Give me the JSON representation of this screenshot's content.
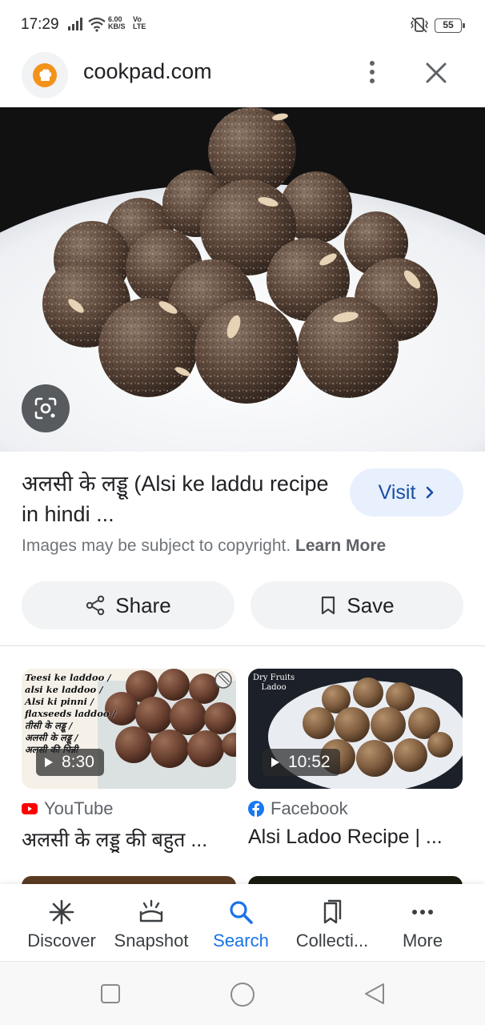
{
  "status_bar": {
    "time": "17:29",
    "net_speed_top": "6.00",
    "net_speed_bottom": "KB/S",
    "net_type_top": "Vo",
    "net_type_bottom": "LTE",
    "battery": "55"
  },
  "header": {
    "site": "cookpad.com",
    "logo_color": "#f3921b"
  },
  "result": {
    "title": "अलसी के लड्डू (Alsi ke laddu recipe in hindi ...",
    "visit_label": "Visit",
    "copyright_text": "Images may be subject to copyright.",
    "learn_more": "Learn More",
    "share_label": "Share",
    "save_label": "Save"
  },
  "related": [
    {
      "duration": "8:30",
      "source": "YouTube",
      "source_icon": "youtube-icon",
      "title": "अलसी के लड्डू की बहुत ...",
      "overlay_lines": [
        "Teesi ke laddoo /",
        "alsi ke laddoo /",
        "Alsi ki pinni /",
        "flaxseeds laddoo /",
        "तीसी के लड्डू /",
        "अलसी के लड्डू /",
        "अलसी की पिन्नी"
      ]
    },
    {
      "duration": "10:52",
      "source": "Facebook",
      "source_icon": "facebook-icon",
      "title": "Alsi Ladoo Recipe | ...",
      "overlay_lines": [
        "Dry Fruits",
        "Ladoo"
      ]
    }
  ],
  "bottom_nav": [
    {
      "label": "Discover",
      "icon": "asterisk-icon",
      "active": false
    },
    {
      "label": "Snapshot",
      "icon": "snapshot-icon",
      "active": false
    },
    {
      "label": "Search",
      "icon": "search-icon",
      "active": true
    },
    {
      "label": "Collecti...",
      "icon": "collections-icon",
      "active": false
    },
    {
      "label": "More",
      "icon": "more-dots-icon",
      "active": false
    }
  ],
  "colors": {
    "accent": "#1a73e8",
    "visit_bg": "#e8f0fe",
    "youtube": "#ff0000",
    "facebook": "#1877f2"
  }
}
